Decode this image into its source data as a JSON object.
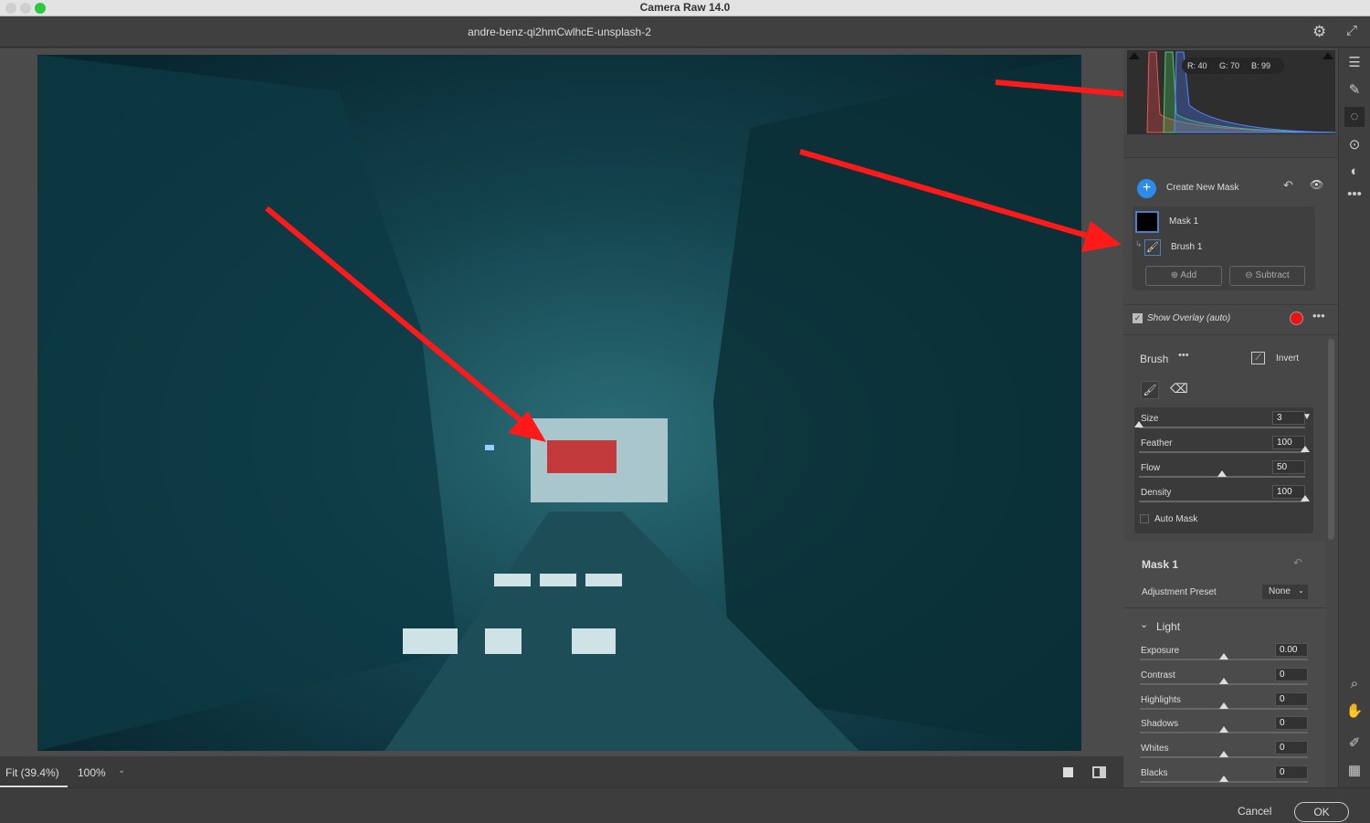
{
  "window": {
    "title": "Camera Raw 14.0",
    "filename": "andre-benz-qi2hmCwlhcE-unsplash-2"
  },
  "histogram": {
    "readout": {
      "r": "R: 40",
      "g": "G: 70",
      "b": "B: 99"
    }
  },
  "masks": {
    "create_label": "Create New Mask",
    "mask_name": "Mask 1",
    "component_name": "Brush 1",
    "add_label": "Add",
    "subtract_label": "Subtract",
    "show_overlay_label": "Show Overlay (auto)",
    "show_overlay_checked": true,
    "overlay_color": "#ee1111"
  },
  "brush": {
    "title": "Brush",
    "invert_label": "Invert",
    "auto_mask_label": "Auto Mask",
    "auto_mask_checked": false,
    "sliders": [
      {
        "label": "Size",
        "value": "3",
        "fraction": 0
      },
      {
        "label": "Feather",
        "value": "100",
        "fraction": 1
      },
      {
        "label": "Flow",
        "value": "50",
        "fraction": 0.5
      },
      {
        "label": "Density",
        "value": "100",
        "fraction": 1
      }
    ]
  },
  "mask_section": {
    "title": "Mask 1",
    "preset_label": "Adjustment Preset",
    "preset_value": "None"
  },
  "light": {
    "title": "Light",
    "sliders": [
      {
        "label": "Exposure",
        "value": "0.00",
        "fraction": 0.5
      },
      {
        "label": "Contrast",
        "value": "0",
        "fraction": 0.5
      },
      {
        "label": "Highlights",
        "value": "0",
        "fraction": 0.5
      },
      {
        "label": "Shadows",
        "value": "0",
        "fraction": 0.5
      },
      {
        "label": "Whites",
        "value": "0",
        "fraction": 0.5
      },
      {
        "label": "Blacks",
        "value": "0",
        "fraction": 0.5
      }
    ]
  },
  "viewbar": {
    "fit_label": "Fit (39.4%)",
    "zoom_label": "100%"
  },
  "footer": {
    "cancel_label": "Cancel",
    "ok_label": "OK"
  },
  "tools": [
    "edit-sliders-icon",
    "healing-bandage-icon",
    "masking-icon",
    "red-eye-icon",
    "presets-icon",
    "more-icon",
    "zoom-icon",
    "hand-icon",
    "color-sampler-icon",
    "grid-icon"
  ],
  "colors": {
    "accent": "#2d8ceb",
    "annotation_arrow": "#ff1a1a"
  }
}
